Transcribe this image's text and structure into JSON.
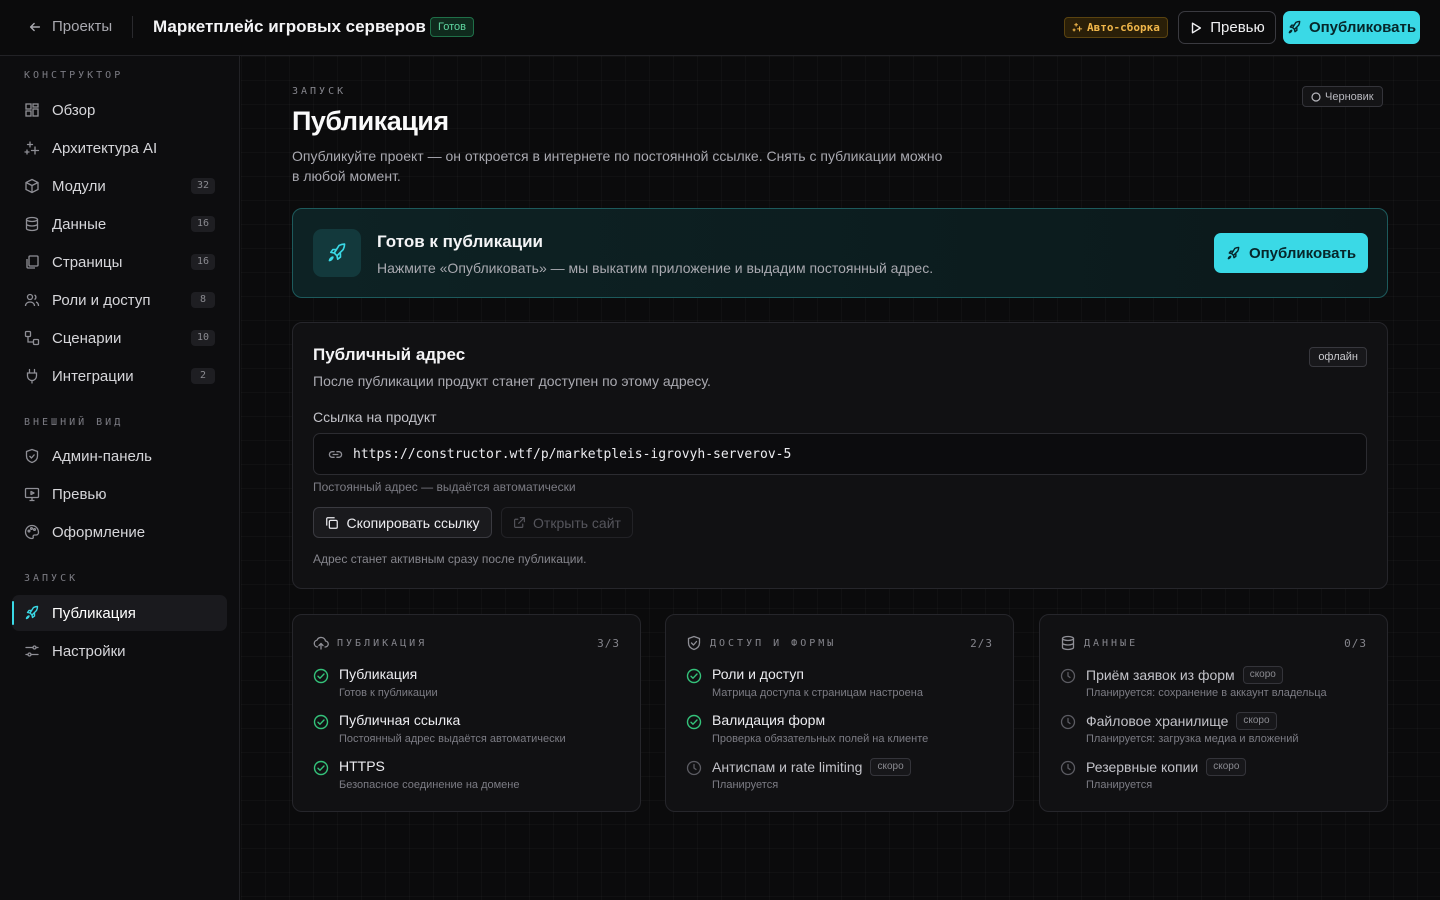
{
  "topbar": {
    "back_label": "Проекты",
    "project_title": "Маркетплейс игровых серверов",
    "status_badge": "Готов",
    "auto_build_badge": "Авто-сборка",
    "preview_label": "Превью",
    "publish_label": "Опубликовать"
  },
  "sidebar": {
    "sections": [
      {
        "title": "КОНСТРУКТОР"
      },
      {
        "title": "ВНЕШНИЙ ВИД"
      },
      {
        "title": "ЗАПУСК"
      }
    ],
    "items": [
      {
        "label": "Обзор",
        "icon": "dashboard-icon"
      },
      {
        "label": "Архитектура AI",
        "icon": "sparkles-icon"
      },
      {
        "label": "Модули",
        "icon": "box-icon",
        "count": "32"
      },
      {
        "label": "Данные",
        "icon": "database-icon",
        "count": "16"
      },
      {
        "label": "Страницы",
        "icon": "pages-icon",
        "count": "16"
      },
      {
        "label": "Роли и доступ",
        "icon": "users-icon",
        "count": "8"
      },
      {
        "label": "Сценарии",
        "icon": "workflow-icon",
        "count": "10"
      },
      {
        "label": "Интеграции",
        "icon": "plug-icon",
        "count": "2"
      },
      {
        "label": "Админ-панель",
        "icon": "shield-icon"
      },
      {
        "label": "Превью",
        "icon": "monitor-icon"
      },
      {
        "label": "Оформление",
        "icon": "palette-icon"
      },
      {
        "label": "Публикация",
        "icon": "rocket-icon",
        "active": true
      },
      {
        "label": "Настройки",
        "icon": "settings-icon"
      }
    ]
  },
  "main": {
    "eyebrow": "ЗАПУСК",
    "title": "Публикация",
    "lead": "Опубликуйте проект — он откроется в интернете по постоянной ссылке. Снять с публикации можно в любой момент.",
    "draft_badge": "Черновик",
    "ready_card": {
      "title": "Готов к публикации",
      "subtitle": "Нажмите «Опубликовать» — мы выкатим приложение и выдадим постоянный адрес.",
      "button": "Опубликовать"
    },
    "address_card": {
      "title": "Публичный адрес",
      "badge": "офлайн",
      "subtitle": "После публикации продукт станет доступен по этому адресу.",
      "field_label": "Ссылка на продукт",
      "url": "https://constructor.wtf/p/marketpleis-igrovyh-serverov-5",
      "hint": "Постоянный адрес — выдаётся автоматически",
      "copy_button": "Скопировать ссылку",
      "open_button": "Открыть сайт",
      "note": "Адрес станет активным сразу после публикации."
    },
    "checklists": [
      {
        "title": "ПУБЛИКАЦИЯ",
        "icon": "cloud-upload-icon",
        "count": "3/3",
        "items": [
          {
            "title": "Публикация",
            "desc": "Готов к публикации",
            "done": true
          },
          {
            "title": "Публичная ссылка",
            "desc": "Постоянный адрес выдаётся автоматически",
            "done": true
          },
          {
            "title": "HTTPS",
            "desc": "Безопасное соединение на домене",
            "done": true
          }
        ]
      },
      {
        "title": "ДОСТУП И ФОРМЫ",
        "icon": "shield-check-icon",
        "count": "2/3",
        "items": [
          {
            "title": "Роли и доступ",
            "desc": "Матрица доступа к страницам настроена",
            "done": true
          },
          {
            "title": "Валидация форм",
            "desc": "Проверка обязательных полей на клиенте",
            "done": true
          },
          {
            "title": "Антиспам и rate limiting",
            "desc": "Планируется",
            "done": false,
            "soon": "скоро"
          }
        ]
      },
      {
        "title": "ДАННЫЕ",
        "icon": "database-icon",
        "count": "0/3",
        "items": [
          {
            "title": "Приём заявок из форм",
            "desc": "Планируется: сохранение в аккаунт владельца",
            "done": false,
            "soon": "скоро"
          },
          {
            "title": "Файловое хранилище",
            "desc": "Планируется: загрузка медиа и вложений",
            "done": false,
            "soon": "скоро"
          },
          {
            "title": "Резервные копии",
            "desc": "Планируется",
            "done": false,
            "soon": "скоро"
          }
        ]
      }
    ]
  },
  "colors": {
    "accent": "#3ad9e6",
    "success": "#34c27a",
    "warning": "#f0b64a",
    "background": "#0b0b0c"
  }
}
